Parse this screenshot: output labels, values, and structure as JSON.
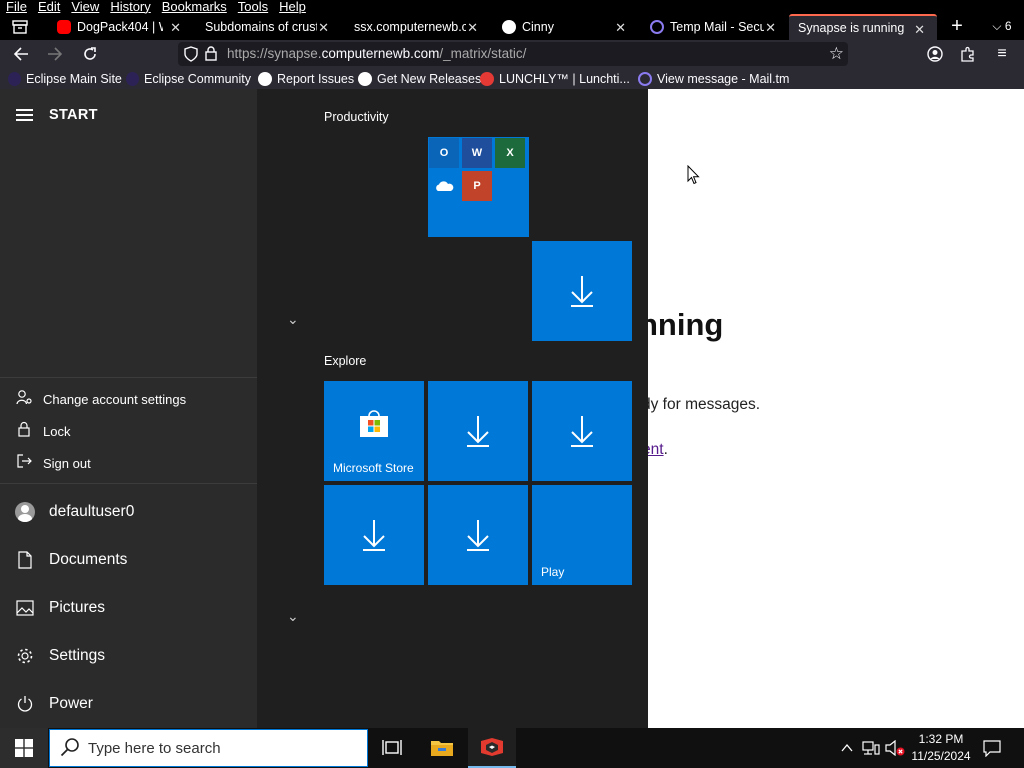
{
  "menubar": [
    "File",
    "Edit",
    "View",
    "History",
    "Bookmarks",
    "Tools",
    "Help"
  ],
  "tabs": [
    {
      "title": "DogPack404 | Wil",
      "icon": "youtube-icon",
      "color": "#ff0000"
    },
    {
      "title": "Subdomains of crusty",
      "icon": "none"
    },
    {
      "title": "ssx.computernewb.co",
      "icon": "none"
    },
    {
      "title": "Cinny",
      "icon": "cinny-icon"
    },
    {
      "title": "Temp Mail - Secu",
      "icon": "at-icon",
      "color": "#7b68ee"
    },
    {
      "title": "Synapse is running",
      "icon": "none",
      "active": true
    }
  ],
  "tab_count": "6",
  "url": {
    "prefix": "https://synapse.",
    "domain": "computernewb.com",
    "path": "/_matrix/static/"
  },
  "bookmarks": [
    {
      "label": "Eclipse Main Site",
      "icon": "eclipse-icon"
    },
    {
      "label": "Eclipse Community",
      "icon": "eclipse-icon"
    },
    {
      "label": "Report Issues",
      "icon": "github-icon"
    },
    {
      "label": "Get New Releases",
      "icon": "github-icon"
    },
    {
      "label": "LUNCHLY™ | Lunchti...",
      "icon": "lunchly-icon"
    },
    {
      "label": "View message - Mail.tm",
      "icon": "at-icon"
    }
  ],
  "page": {
    "heading": "nning",
    "line1": "dy for messages.",
    "line2_link": "ent",
    "line2_tail": "."
  },
  "start": {
    "title": "START",
    "flyout": [
      "Change account settings",
      "Lock",
      "Sign out"
    ],
    "user": "defaultuser0",
    "nav": [
      "Documents",
      "Pictures",
      "Settings",
      "Power"
    ],
    "groups": [
      "Productivity",
      "Explore"
    ],
    "tiles": {
      "store": "Microsoft Store",
      "play": "Play"
    },
    "office_apps": [
      "Outlook",
      "Word",
      "Excel",
      "OneDrive",
      "PowerPoint"
    ]
  },
  "taskbar": {
    "search_placeholder": "Type here to search",
    "time": "1:32 PM",
    "date": "11/25/2024"
  },
  "colors": {
    "tile_blue": "#0078d7",
    "tab_accent": "#ff6a4f"
  }
}
